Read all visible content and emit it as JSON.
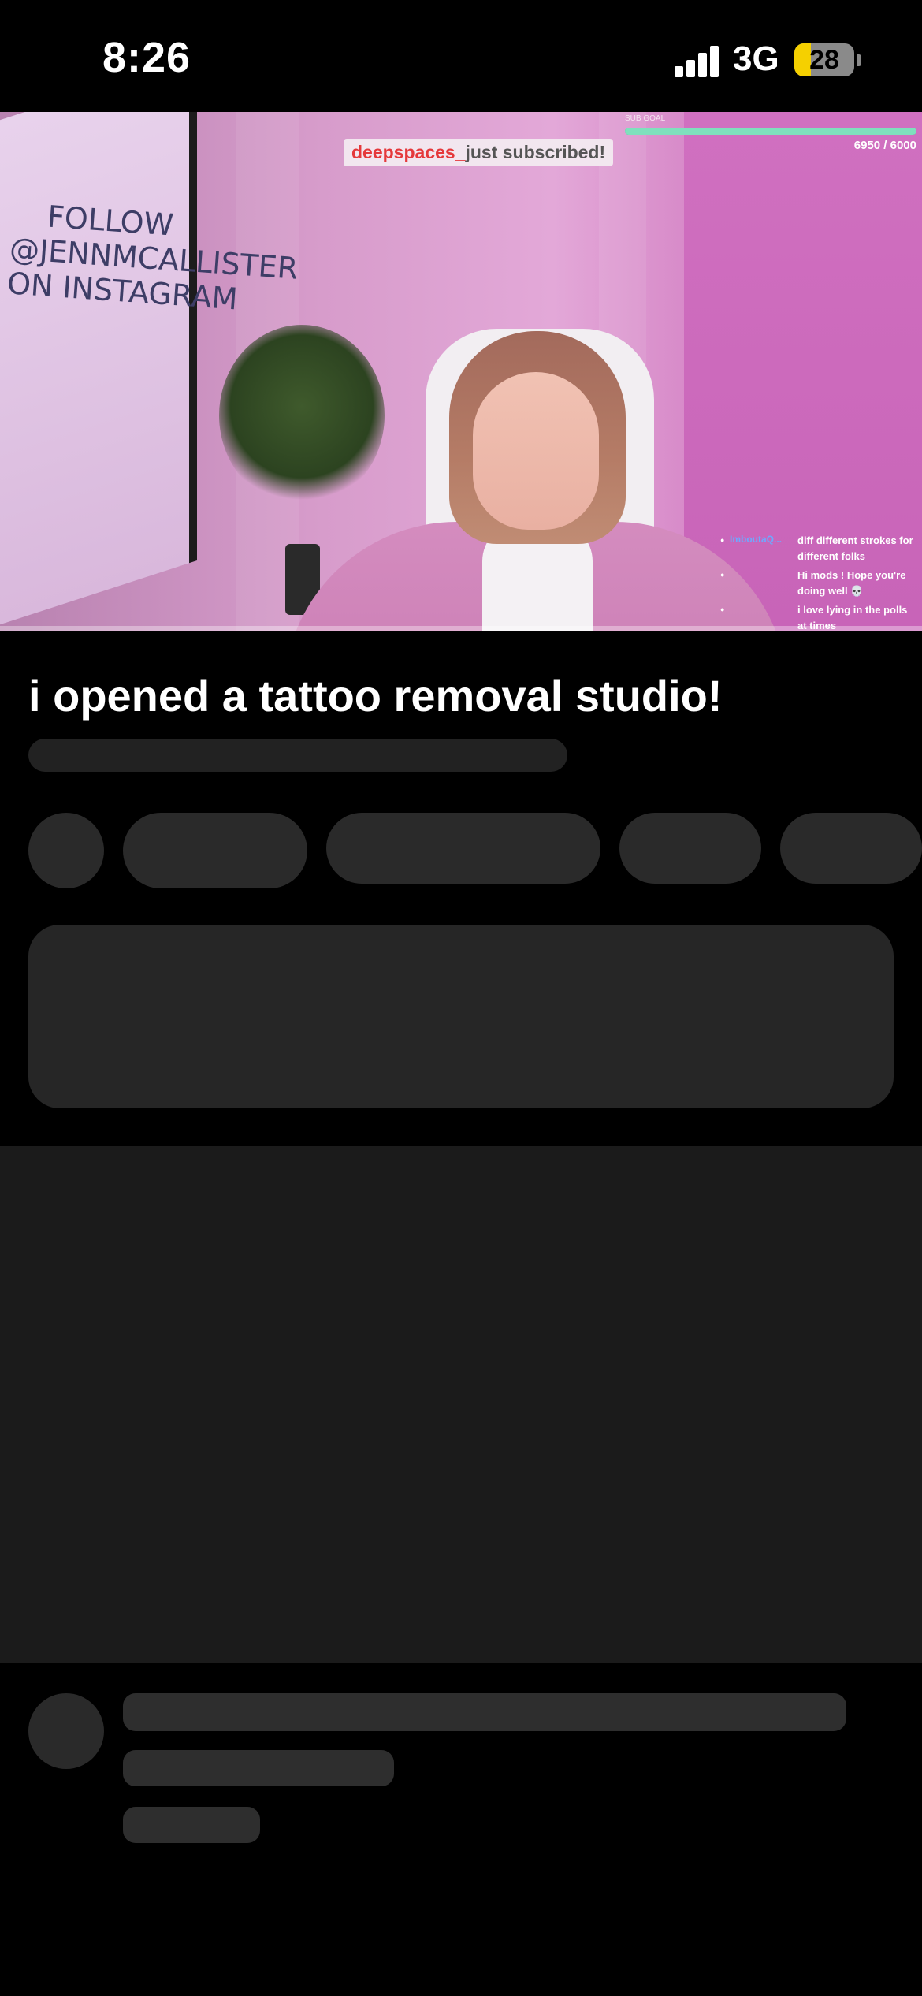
{
  "status_bar": {
    "time": "8:26",
    "network": "3G",
    "battery_level": "28",
    "icons": [
      "signal-icon",
      "battery-icon"
    ]
  },
  "video": {
    "whiteboard_text": [
      "FOLLOW",
      "@JENNMCALLISTER",
      "ON INSTAGRAM"
    ],
    "sub_alert": {
      "username": "deepspaces_",
      "message": "just subscribed!"
    },
    "sub_goal": {
      "label": "SUB GOAL",
      "count": "6950 / 6000",
      "progress": 1.0,
      "colors": {
        "track": "#3a9d7c",
        "fill": "#7fe0bd"
      }
    },
    "chat": [
      {
        "user": "ImboutaQ...",
        "message": "diff different strokes for different folks",
        "color": "#6fa8ff"
      },
      {
        "user": "",
        "message": "Hi mods ! Hope you're doing well 💀",
        "color": "#2f8f2f"
      },
      {
        "user": "",
        "message": "i love lying in the polls at times",
        "color": "#ff4f9a"
      }
    ]
  },
  "title": "i opened a tattoo removal studio!",
  "colors": {
    "background": "#000000",
    "skeleton": "#2a2a2a",
    "panel": "#1b1b1b"
  }
}
